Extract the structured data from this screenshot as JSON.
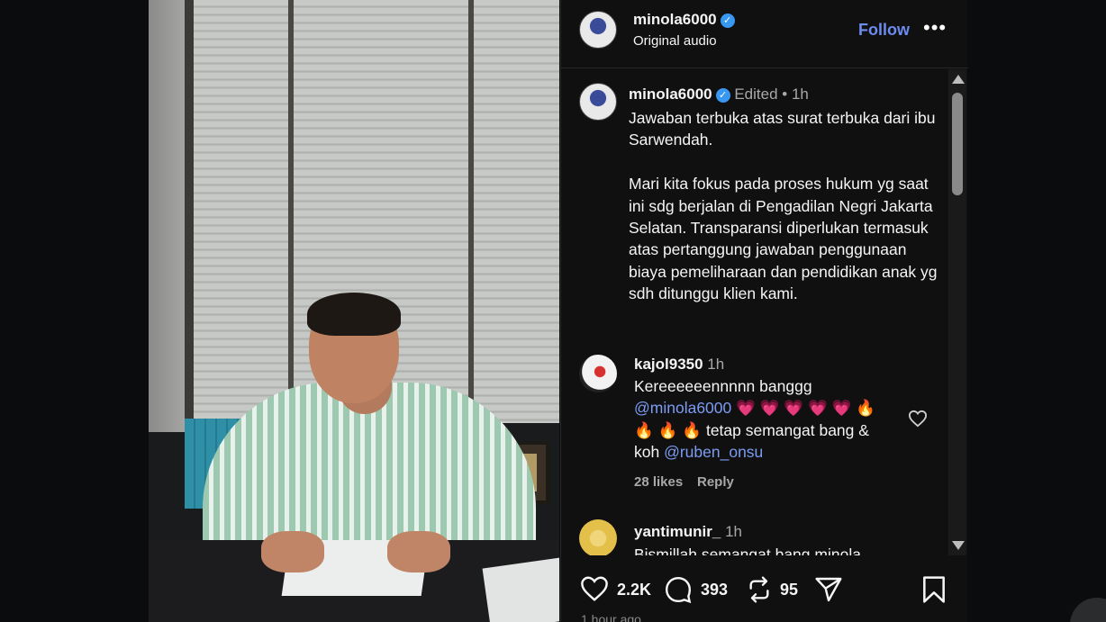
{
  "header": {
    "username": "minola6000",
    "audio": "Original audio",
    "follow_label": "Follow",
    "more_label": "•••"
  },
  "caption": {
    "username": "minola6000",
    "edited": "Edited",
    "time": "1h",
    "text": "Jawaban terbuka atas surat terbuka dari ibu Sarwendah.\n\nMari kita fokus pada proses hukum yg saat ini sdg berjalan di Pengadilan Negri Jakarta Selatan. Transparansi diperlukan termasuk atas pertanggung jawaban penggunaan biaya pemeliharaan dan pendidikan anak yg sdh ditunggu klien kami."
  },
  "comments": [
    {
      "username": "kajol9350",
      "time": "1h",
      "line1": "Kereeeeeennnnn banggg",
      "mention1": "@minola6000",
      "emojis1": "💗 💗 💗 💗 💗 🔥",
      "emojis2": "🔥 🔥 🔥",
      "text2": " tetap semangat bang &",
      "text3": "koh ",
      "mention2": "@ruben_onsu",
      "likes": "28 likes",
      "reply": "Reply"
    },
    {
      "username": "yantimunir_",
      "time": "1h",
      "text": "Bismillah semangat bang minola"
    }
  ],
  "actions": {
    "likes": "2.2K",
    "comments": "393",
    "reposts": "95"
  },
  "timestamp": "1 hour ago",
  "colors": {
    "accent": "#6d8cf0",
    "mention": "#7c9cf3",
    "verified": "#3897f0",
    "background": "#101010"
  }
}
